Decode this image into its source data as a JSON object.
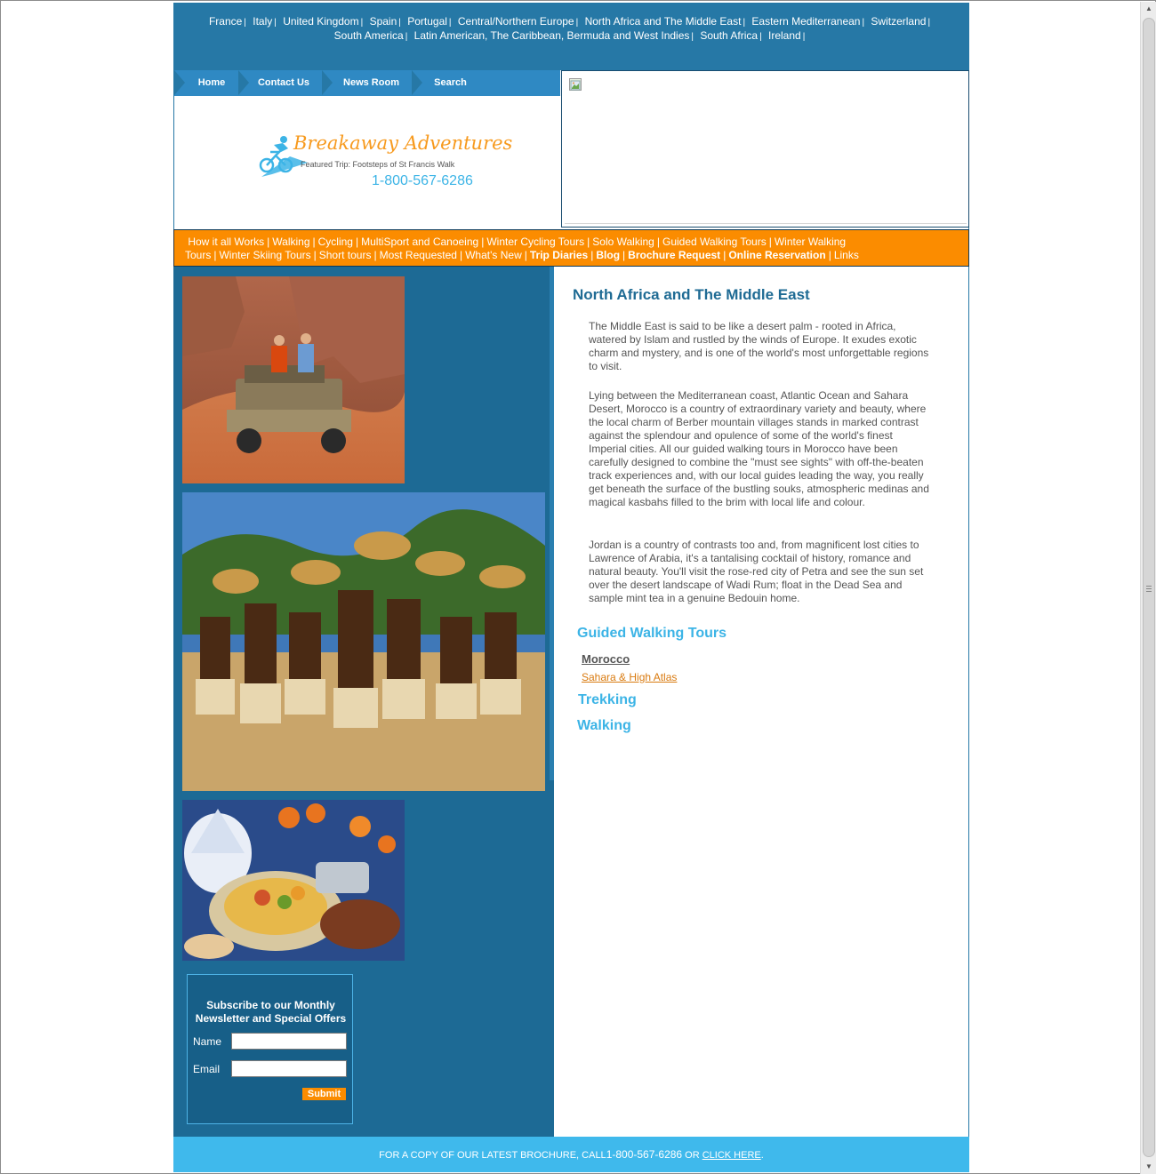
{
  "destinations": {
    "row1": [
      "France",
      "Italy",
      "United Kingdom",
      "Spain",
      "Portugal",
      "Central/Northern Europe",
      "North Africa and The Middle East",
      "Eastern Mediterranean",
      "Switzerland"
    ],
    "row2": [
      "South America",
      "Latin American, The Caribbean, Bermuda and West Indies",
      "South Africa",
      "Ireland"
    ],
    "separator": "|"
  },
  "mainnav": {
    "home": "Home",
    "contact": "Contact Us",
    "news": "News Room",
    "search": "Search"
  },
  "logo": {
    "brand": "Breakaway Adventures",
    "featured": "Featured Trip: Footsteps of St Francis Walk",
    "phone": "1-800-567-6286"
  },
  "activities": {
    "items": [
      {
        "label": "How it all Works",
        "bold": false
      },
      {
        "label": "Walking",
        "bold": false
      },
      {
        "label": "Cycling",
        "bold": false
      },
      {
        "label": "MultiSport and Canoeing",
        "bold": false
      },
      {
        "label": "Winter Cycling Tours",
        "bold": false
      },
      {
        "label": "Solo Walking",
        "bold": false
      },
      {
        "label": "Guided Walking Tours",
        "bold": false
      },
      {
        "label": "Winter Walking Tours",
        "bold": false
      },
      {
        "label": "Winter Skiing Tours",
        "bold": false
      },
      {
        "label": "Short tours",
        "bold": false
      },
      {
        "label": "Most Requested",
        "bold": false
      },
      {
        "label": "What's New",
        "bold": false
      },
      {
        "label": "Trip Diaries",
        "bold": true
      },
      {
        "label": "Blog",
        "bold": true
      },
      {
        "label": "Brochure Request",
        "bold": true
      },
      {
        "label": "Online Reservation",
        "bold": true
      },
      {
        "label": "Links",
        "bold": false
      }
    ]
  },
  "content": {
    "heading": "North Africa and The Middle East",
    "para1": "The Middle East is said to be like a desert palm - rooted in Africa, watered by Islam and rustled by the winds of Europe. It exudes exotic charm and mystery, and is one of the world's most unforgettable regions to visit.",
    "para2": "Lying between the Mediterranean coast, Atlantic Ocean and Sahara Desert, Morocco is a country of extraordinary variety and beauty, where the local charm of Berber mountain villages stands in marked contrast against the splendour and opulence of some of the world's finest Imperial cities. All our guided walking tours in Morocco have been carefully designed to combine the \"must see sights\" with off-the-beaten track experiences and, with our local guides leading the way, you really get beneath the surface of the bustling souks, atmospheric medinas and magical kasbahs filled to the brim with local life and colour.",
    "para3": "Jordan is a country of contrasts too and, from magnificent lost cities to Lawrence of Arabia, it's a tantalising cocktail of history, romance and natural beauty. You'll visit the rose-red city of Petra and see the sun set over the desert landscape of Wadi Rum; float in the Dead Sea and sample mint tea in a genuine Bedouin home.",
    "guided_heading": "Guided Walking Tours",
    "region": "Morocco",
    "trip": "Sahara & High Atlas",
    "trekking_heading": "Trekking",
    "walking_heading": "Walking"
  },
  "newsletter": {
    "title_line1": "Subscribe to our Monthly",
    "title_line2": "Newsletter and Special Offers",
    "name_label": "Name",
    "email_label": "Email",
    "name_value": "",
    "email_value": "",
    "submit": "Submit"
  },
  "footer": {
    "text": "FOR A COPY OF OUR LATEST BROCHURE, CALL",
    "phone": "1-800-567-6286",
    "or": " OR ",
    "link": "CLICK HERE",
    "end": "."
  },
  "colors": {
    "topbar": "#2678a6",
    "nav": "#2f89c3",
    "activity_bar": "#fb8c00",
    "sidebar": "#1d6a95",
    "heading": "#1f6b94",
    "section_heading": "#3cb4e6",
    "footer": "#3fb9ec"
  },
  "icons": {
    "broken_image": "broken-image-icon",
    "cyclist_logo": "cyclist-icon"
  }
}
